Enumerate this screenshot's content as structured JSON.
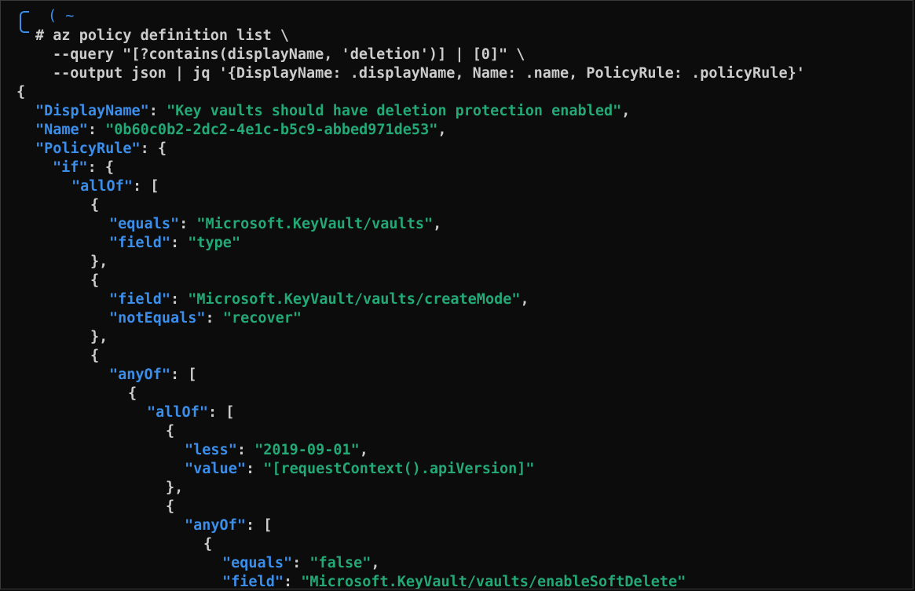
{
  "prompt": {
    "paren": "(",
    "dir": "~",
    "hash": "#"
  },
  "command": {
    "line1": "az policy definition list \\",
    "line2": "--query \"[?contains(displayName, 'deletion')] | [0]\" \\",
    "line3": "--output json | jq '{DisplayName: .displayName, Name: .name, PolicyRule: .policyRule}'"
  },
  "output": {
    "open_brace": "{",
    "display_name_key": "\"DisplayName\"",
    "display_name_value": "\"Key vaults should have deletion protection enabled\"",
    "name_key": "\"Name\"",
    "name_value": "\"0b60c0b2-2dc2-4e1c-b5c9-abbed971de53\"",
    "policy_rule_key": "\"PolicyRule\"",
    "if_key": "\"if\"",
    "allof_key": "\"allOf\"",
    "equals_key": "\"equals\"",
    "equals_value_1": "\"Microsoft.KeyVault/vaults\"",
    "field_key": "\"field\"",
    "field_value_1": "\"type\"",
    "field_value_2": "\"Microsoft.KeyVault/vaults/createMode\"",
    "notequals_key": "\"notEquals\"",
    "notequals_value": "\"recover\"",
    "anyof_key": "\"anyOf\"",
    "less_key": "\"less\"",
    "less_value": "\"2019-09-01\"",
    "value_key": "\"value\"",
    "value_value": "\"[requestContext().apiVersion]\"",
    "equals_value_2": "\"false\"",
    "field_value_3": "\"Microsoft.KeyVault/vaults/enableSoftDelete\""
  },
  "colors": {
    "background": "#0c0c0c",
    "key": "#3b8eea",
    "string": "#23a876",
    "punctuation": "#cccccc"
  }
}
